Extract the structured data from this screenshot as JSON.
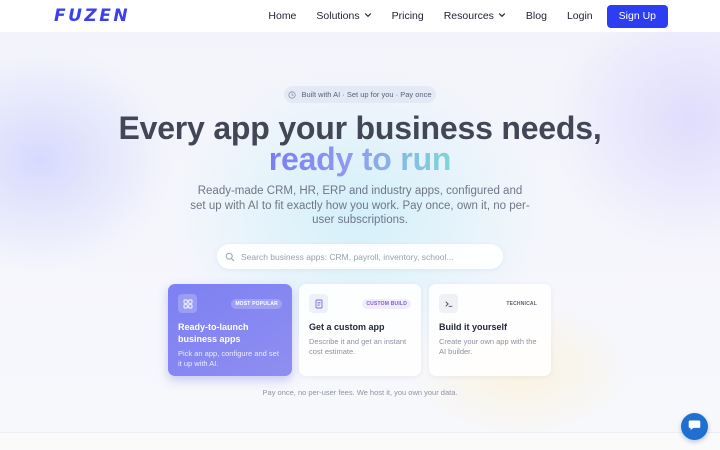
{
  "brand": {
    "logo_text": "FUZEN",
    "accent": "#2d3ef2"
  },
  "nav": {
    "items": [
      {
        "label": "Home"
      },
      {
        "label": "Solutions"
      },
      {
        "label": "Pricing"
      },
      {
        "label": "Resources"
      },
      {
        "label": "Blog"
      },
      {
        "label": "Login"
      }
    ],
    "signup_label": "Sign Up"
  },
  "hero": {
    "badge": "Built with AI · Set up for you · Pay once",
    "title_line1": "Every app your business needs,",
    "title_line2": "ready to run",
    "subtitle": "Ready-made CRM, HR, ERP and industry apps, configured and set up with AI to fit exactly how you work. Pay once, own it, no per-user subscriptions."
  },
  "search": {
    "placeholder": "Search business apps: CRM, payroll, inventory, school...",
    "value": ""
  },
  "cards": [
    {
      "tag": "MOST POPULAR",
      "title": "Ready-to-launch business apps",
      "desc": "Pick an app, configure and set it up with AI.",
      "icon": "grid-icon"
    },
    {
      "tag": "CUSTOM BUILD",
      "title": "Get a custom app",
      "desc": "Describe it and get an instant cost estimate.",
      "icon": "document-icon"
    },
    {
      "tag": "TECHNICAL",
      "title": "Build it yourself",
      "desc": "Create your own app with the AI builder.",
      "icon": "terminal-icon"
    }
  ],
  "footnote": "Pay once, no per-user fees. We host it, you own your data.",
  "chat": {
    "icon": "chat-bubble-icon",
    "color": "#1f6fd1"
  }
}
